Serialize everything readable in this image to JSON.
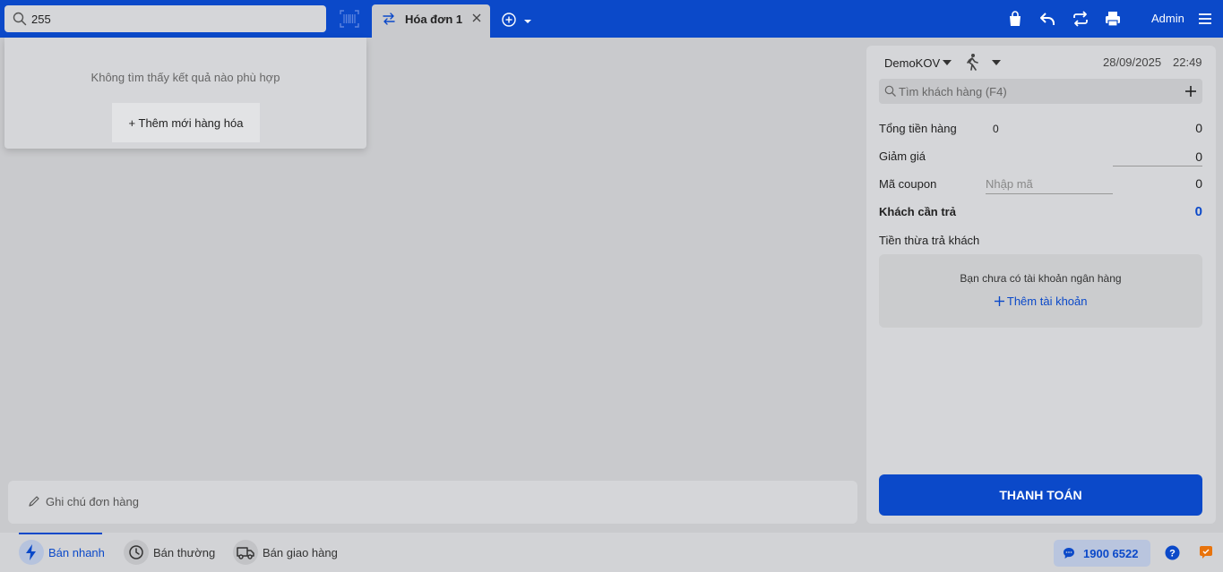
{
  "header": {
    "search_value": "255",
    "tab_label": "Hóa đơn 1",
    "user_label": "Admin"
  },
  "search_dropdown": {
    "no_result_text": "Không tìm thấy kết quả nào phù hợp",
    "add_product_label": "+ Thêm mới hàng hóa"
  },
  "note": {
    "placeholder": "Ghi chú đơn hàng"
  },
  "panel": {
    "store_name": "DemoKOV",
    "date": "28/09/2025",
    "time": "22:49",
    "customer_search_placeholder": "Tìm khách hàng (F4)",
    "total_label": "Tổng tiền hàng",
    "total_qty": "0",
    "total_value": "0",
    "discount_label": "Giảm giá",
    "discount_value": "0",
    "coupon_label": "Mã coupon",
    "coupon_placeholder": "Nhập mã",
    "coupon_value": "0",
    "customer_pay_label": "Khách cần trả",
    "customer_pay_value": "0",
    "change_label": "Tiền thừa trả khách",
    "bank_message": "Bạn chưa có tài khoản ngân hàng",
    "add_bank_label": "Thêm tài khoản",
    "pay_button": "THANH TOÁN"
  },
  "bottom": {
    "modes": [
      {
        "label": "Bán nhanh",
        "icon": "lightning-icon",
        "active": true
      },
      {
        "label": "Bán thường",
        "icon": "clock-icon",
        "active": false
      },
      {
        "label": "Bán giao hàng",
        "icon": "truck-icon",
        "active": false
      }
    ],
    "hotline": "1900 6522"
  },
  "colors": {
    "brand": "#0b49c9",
    "background": "#c9cacd",
    "panel": "#d5d6d9"
  }
}
